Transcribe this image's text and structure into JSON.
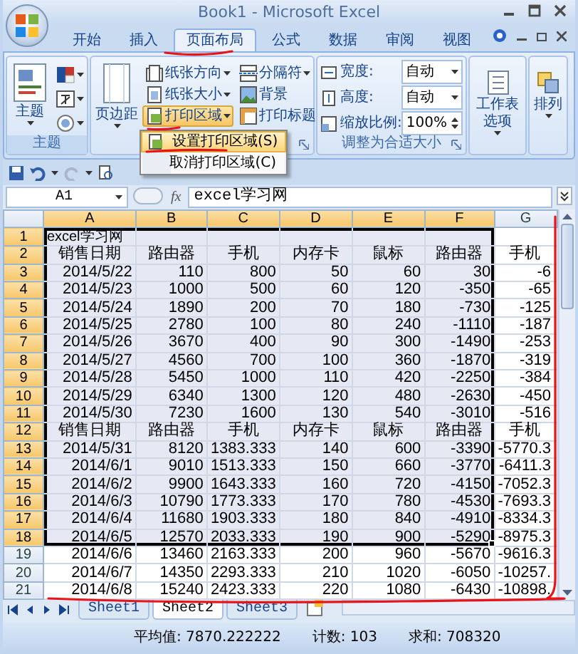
{
  "window": {
    "title": "Book1 - Microsoft Excel"
  },
  "ribbon_tabs": [
    {
      "label": "开始",
      "selected": false
    },
    {
      "label": "插入",
      "selected": false
    },
    {
      "label": "页面布局",
      "selected": true
    },
    {
      "label": "公式",
      "selected": false
    },
    {
      "label": "数据",
      "selected": false
    },
    {
      "label": "审阅",
      "selected": false
    },
    {
      "label": "视图",
      "selected": false
    }
  ],
  "theme_group": {
    "button": "主题",
    "label": "主题"
  },
  "page_setup_group": {
    "margins": "页边距",
    "small_buttons": [
      {
        "label": "纸张方向",
        "dropdown": true,
        "open": false
      },
      {
        "label": "纸张大小",
        "dropdown": true,
        "open": false
      },
      {
        "label": "打印区域",
        "dropdown": true,
        "open": true
      },
      {
        "label": "分隔符",
        "dropdown": true,
        "open": false
      },
      {
        "label": "背景",
        "dropdown": false,
        "open": false
      },
      {
        "label": "打印标题",
        "dropdown": false,
        "open": false
      }
    ]
  },
  "scale_group": {
    "label": "调整为合适大小",
    "fields": [
      {
        "label": "宽度:",
        "value": "自动",
        "kind": "dropdown"
      },
      {
        "label": "高度:",
        "value": "自动",
        "kind": "dropdown"
      },
      {
        "label": "缩放比例:",
        "value": "100%",
        "kind": "spinner"
      }
    ]
  },
  "sheet_options": "工作表选项",
  "arrange": "排列",
  "print_area_menu": [
    {
      "label": "设置打印区域(S)",
      "selected": true
    },
    {
      "label": "取消打印区域(C)",
      "selected": false
    }
  ],
  "formula_bar": {
    "name_box": "A1",
    "fx": "fx",
    "formula": "excel学习网"
  },
  "columns": [
    {
      "label": "A",
      "selected": true
    },
    {
      "label": "B",
      "selected": true
    },
    {
      "label": "C",
      "selected": true
    },
    {
      "label": "D",
      "selected": true
    },
    {
      "label": "E",
      "selected": true
    },
    {
      "label": "F",
      "selected": true
    },
    {
      "label": "G",
      "selected": false
    }
  ],
  "rows": [
    {
      "number": "1",
      "selected": true,
      "kind": "title",
      "cells": [
        "excel学习网"
      ]
    },
    {
      "number": "2",
      "selected": true,
      "kind": "header",
      "cells": [
        "销售日期",
        "路由器",
        "手机",
        "内存卡",
        "鼠标",
        "路由器",
        "手机"
      ]
    },
    {
      "number": "3",
      "selected": true,
      "kind": "data",
      "cells": [
        "2014/5/22",
        "110",
        "800",
        "50",
        "60",
        "30",
        "-6"
      ]
    },
    {
      "number": "4",
      "selected": true,
      "kind": "data",
      "cells": [
        "2014/5/23",
        "1000",
        "500",
        "60",
        "120",
        "-350",
        "-65"
      ]
    },
    {
      "number": "5",
      "selected": true,
      "kind": "data",
      "cells": [
        "2014/5/24",
        "1890",
        "200",
        "70",
        "180",
        "-730",
        "-125"
      ]
    },
    {
      "number": "6",
      "selected": true,
      "kind": "data",
      "cells": [
        "2014/5/25",
        "2780",
        "100",
        "80",
        "240",
        "-1110",
        "-187"
      ]
    },
    {
      "number": "7",
      "selected": true,
      "kind": "data",
      "cells": [
        "2014/5/26",
        "3670",
        "400",
        "90",
        "300",
        "-1490",
        "-253"
      ]
    },
    {
      "number": "8",
      "selected": true,
      "kind": "data",
      "cells": [
        "2014/5/27",
        "4560",
        "700",
        "100",
        "360",
        "-1870",
        "-319"
      ]
    },
    {
      "number": "9",
      "selected": true,
      "kind": "data",
      "cells": [
        "2014/5/28",
        "5450",
        "1000",
        "110",
        "420",
        "-2250",
        "-384"
      ]
    },
    {
      "number": "10",
      "selected": true,
      "kind": "data",
      "cells": [
        "2014/5/29",
        "6340",
        "1300",
        "120",
        "480",
        "-2630",
        "-450"
      ]
    },
    {
      "number": "11",
      "selected": true,
      "kind": "data",
      "cells": [
        "2014/5/30",
        "7230",
        "1600",
        "130",
        "540",
        "-3010",
        "-516"
      ]
    },
    {
      "number": "12",
      "selected": true,
      "kind": "header",
      "cells": [
        "销售日期",
        "路由器",
        "手机",
        "内存卡",
        "鼠标",
        "路由器",
        "手机"
      ]
    },
    {
      "number": "13",
      "selected": true,
      "kind": "data",
      "cells": [
        "2014/5/31",
        "8120",
        "1383.333",
        "140",
        "600",
        "-3390",
        "-5770.3"
      ]
    },
    {
      "number": "14",
      "selected": true,
      "kind": "data",
      "cells": [
        "2014/6/1",
        "9010",
        "1513.333",
        "150",
        "660",
        "-3770",
        "-6411.3"
      ]
    },
    {
      "number": "15",
      "selected": true,
      "kind": "data",
      "cells": [
        "2014/6/2",
        "9900",
        "1643.333",
        "160",
        "720",
        "-4150",
        "-7052.3"
      ]
    },
    {
      "number": "16",
      "selected": true,
      "kind": "data",
      "cells": [
        "2014/6/3",
        "10790",
        "1773.333",
        "170",
        "780",
        "-4530",
        "-7693.3"
      ]
    },
    {
      "number": "17",
      "selected": true,
      "kind": "data",
      "cells": [
        "2014/6/4",
        "11680",
        "1903.333",
        "180",
        "840",
        "-4910",
        "-8334.3"
      ]
    },
    {
      "number": "18",
      "selected": true,
      "kind": "data",
      "cells": [
        "2014/6/5",
        "12570",
        "2033.333",
        "190",
        "900",
        "-5290",
        "-8975.3"
      ]
    },
    {
      "number": "19",
      "selected": false,
      "kind": "data",
      "cells": [
        "2014/6/6",
        "13460",
        "2163.333",
        "200",
        "960",
        "-5670",
        "-9616.3"
      ]
    },
    {
      "number": "20",
      "selected": false,
      "kind": "data",
      "cells": [
        "2014/6/7",
        "14350",
        "2293.333",
        "210",
        "1020",
        "-6050",
        "-10257."
      ]
    },
    {
      "number": "21",
      "selected": false,
      "kind": "data",
      "cells": [
        "2014/6/8",
        "15240",
        "2423.333",
        "220",
        "1080",
        "-6430",
        "-10898."
      ]
    }
  ],
  "sheet_tabs": [
    {
      "label": "Sheet1",
      "selected": false
    },
    {
      "label": "Sheet2",
      "selected": true
    },
    {
      "label": "Sheet3",
      "selected": false
    }
  ],
  "status_bar": [
    "平均值: 7870.222222",
    "计数: 103",
    "求和: 708320"
  ]
}
